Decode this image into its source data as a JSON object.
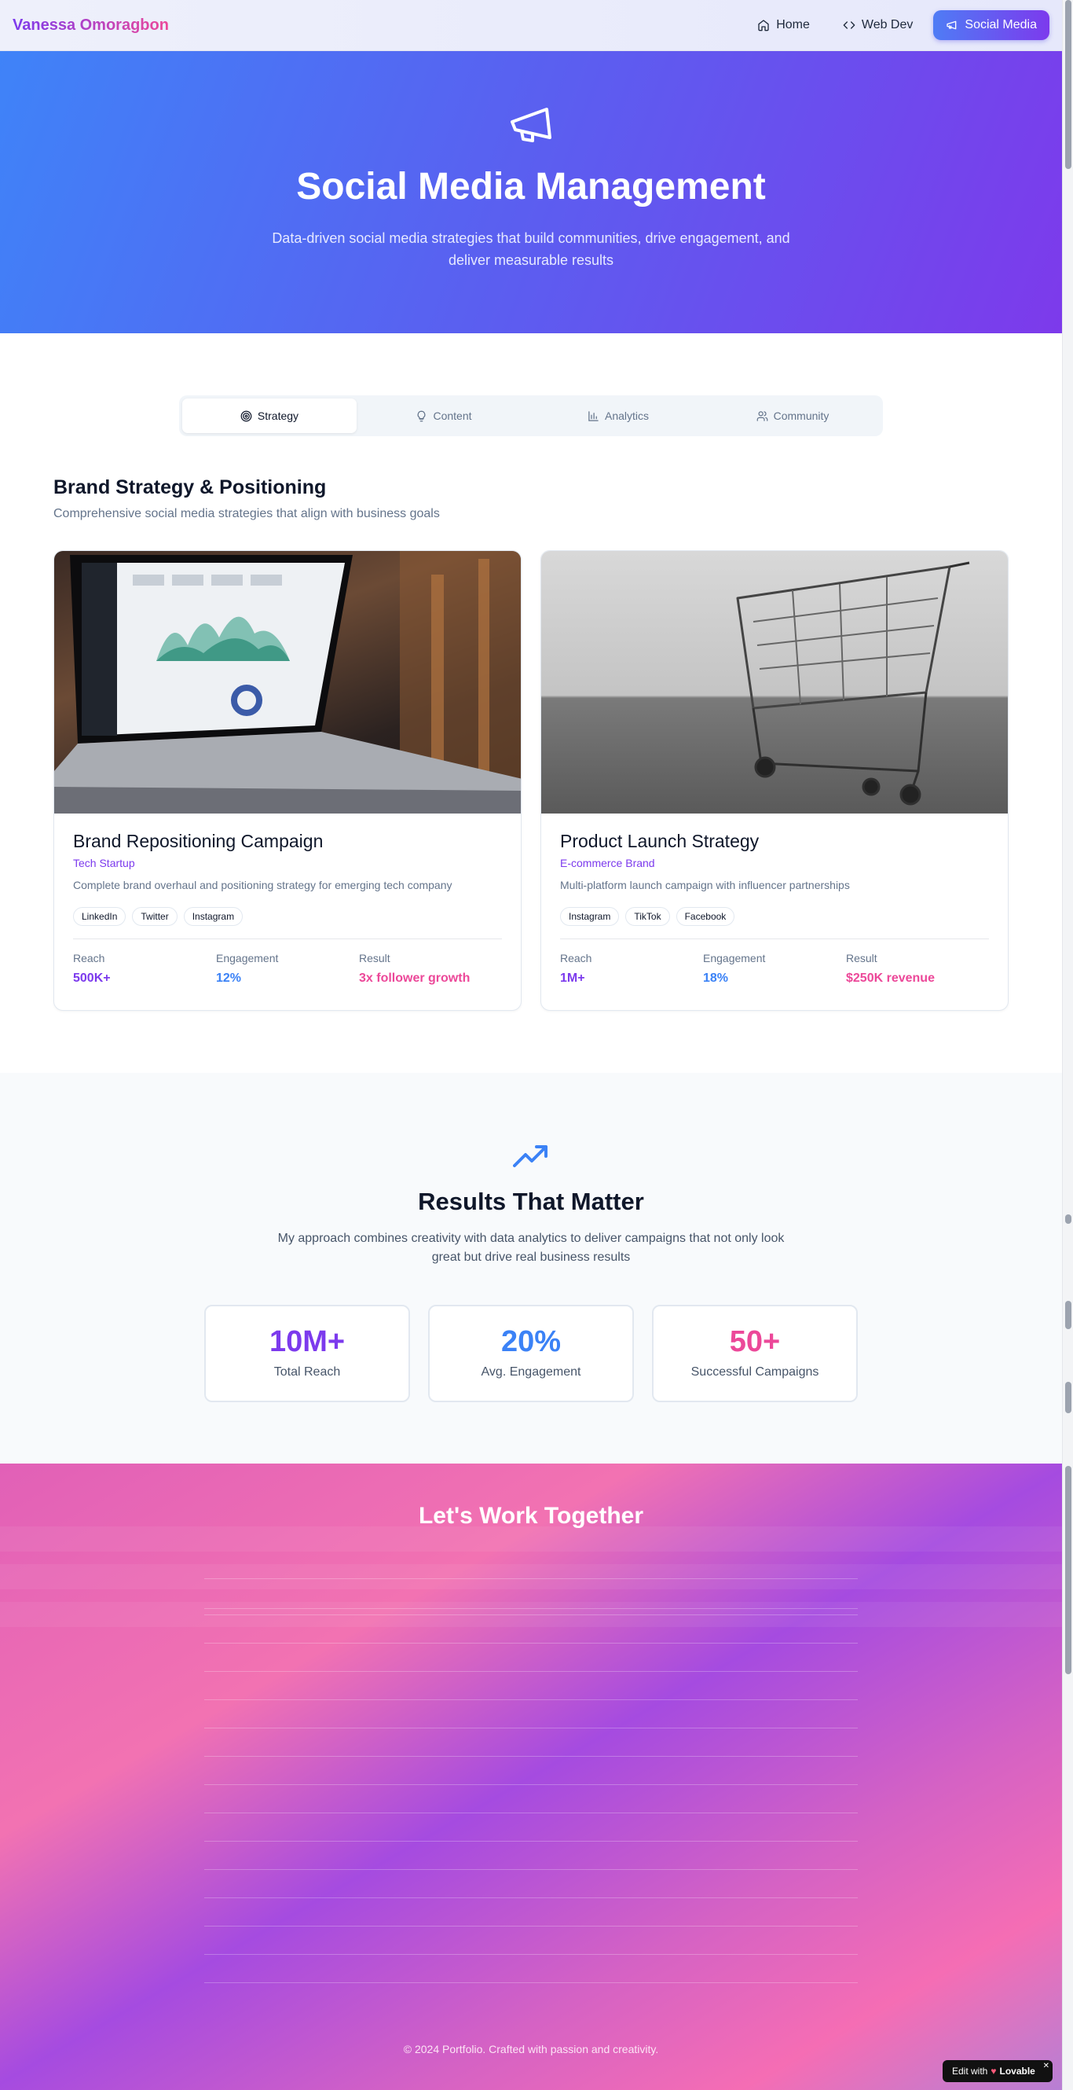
{
  "nav": {
    "brand": "Vanessa Omoragbon",
    "links": [
      {
        "label": "Home",
        "icon": "home-icon"
      },
      {
        "label": "Web Dev",
        "icon": "code-icon"
      },
      {
        "label": "Social Media",
        "icon": "megaphone-icon",
        "active": true
      }
    ]
  },
  "hero": {
    "title": "Social Media Management",
    "subtitle": "Data-driven social media strategies that build communities, drive engagement, and deliver measurable results"
  },
  "tabs": [
    {
      "label": "Strategy",
      "icon": "target-icon",
      "active": true
    },
    {
      "label": "Content",
      "icon": "lightbulb-icon"
    },
    {
      "label": "Analytics",
      "icon": "bar-chart-icon"
    },
    {
      "label": "Community",
      "icon": "users-icon"
    }
  ],
  "section": {
    "title": "Brand Strategy & Positioning",
    "subtitle": "Comprehensive social media strategies that align with business goals"
  },
  "cards": [
    {
      "title": "Brand Repositioning Campaign",
      "client": "Tech Startup",
      "description": "Complete brand overhaul and positioning strategy for emerging tech company",
      "platforms": [
        "LinkedIn",
        "Twitter",
        "Instagram"
      ],
      "metrics": [
        {
          "label": "Reach",
          "value": "500K+"
        },
        {
          "label": "Engagement",
          "value": "12%"
        },
        {
          "label": "Result",
          "value": "3x follower growth"
        }
      ]
    },
    {
      "title": "Product Launch Strategy",
      "client": "E-commerce Brand",
      "description": "Multi-platform launch campaign with influencer partnerships",
      "platforms": [
        "Instagram",
        "TikTok",
        "Facebook"
      ],
      "metrics": [
        {
          "label": "Reach",
          "value": "1M+"
        },
        {
          "label": "Engagement",
          "value": "18%"
        },
        {
          "label": "Result",
          "value": "$250K revenue"
        }
      ]
    }
  ],
  "results": {
    "title": "Results That Matter",
    "subtitle": "My approach combines creativity with data analytics to deliver campaigns that not only look great but drive real business results",
    "stats": [
      {
        "value": "10M+",
        "label": "Total Reach",
        "color": "#7c3aed"
      },
      {
        "value": "20%",
        "label": "Avg. Engagement",
        "color": "#3b82f6"
      },
      {
        "value": "50+",
        "label": "Successful Campaigns",
        "color": "#ec4899"
      }
    ]
  },
  "contact": {
    "title": "Let's Work Together"
  },
  "footer": {
    "text": "© 2024 Portfolio. Crafted with passion and creativity."
  },
  "badge": {
    "prefix": "Edit with",
    "name": "Lovable"
  },
  "colors": {
    "metric_reach": "#7c3aed",
    "metric_engagement": "#3b82f6",
    "metric_result": "#ec4899"
  }
}
